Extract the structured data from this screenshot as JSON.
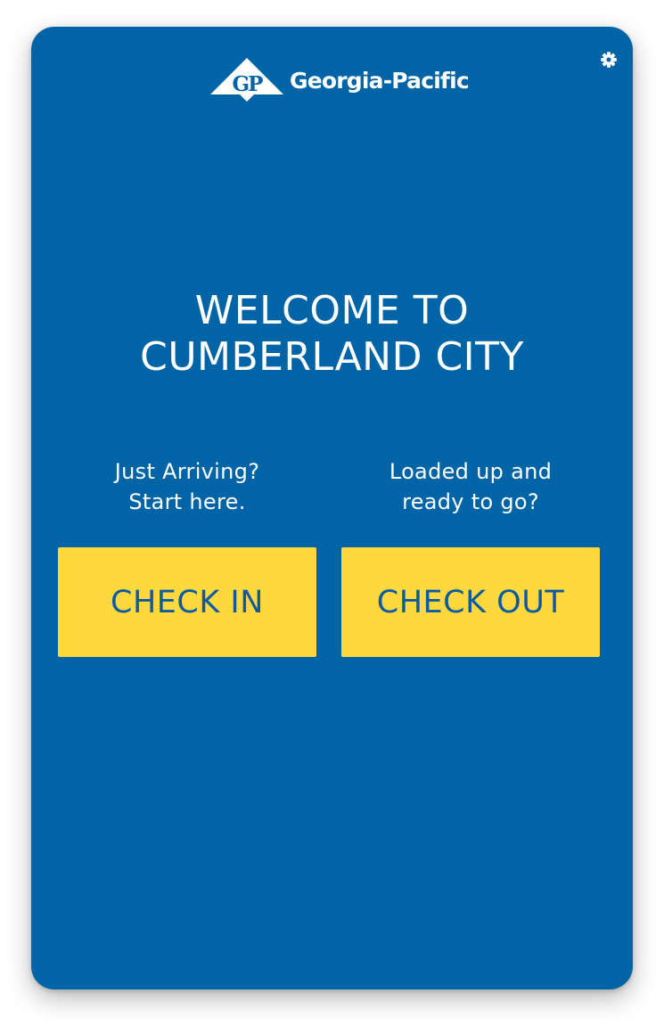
{
  "logo": {
    "monogram": "GP",
    "name": "Georgia-Pacific"
  },
  "settings": {
    "icon": "gear-icon"
  },
  "welcome": {
    "line1": "WELCOME TO",
    "line2": "CUMBERLAND CITY"
  },
  "check_in": {
    "prompt_line1": "Just Arriving?",
    "prompt_line2": "Start here.",
    "button_label": "CHECK IN"
  },
  "check_out": {
    "prompt_line1": "Loaded up and",
    "prompt_line2": "ready to go?",
    "button_label": "CHECK OUT"
  },
  "colors": {
    "background": "#0064a6",
    "button": "#fdd93d",
    "button_text": "#0c5ba0",
    "text": "#ffffff"
  }
}
